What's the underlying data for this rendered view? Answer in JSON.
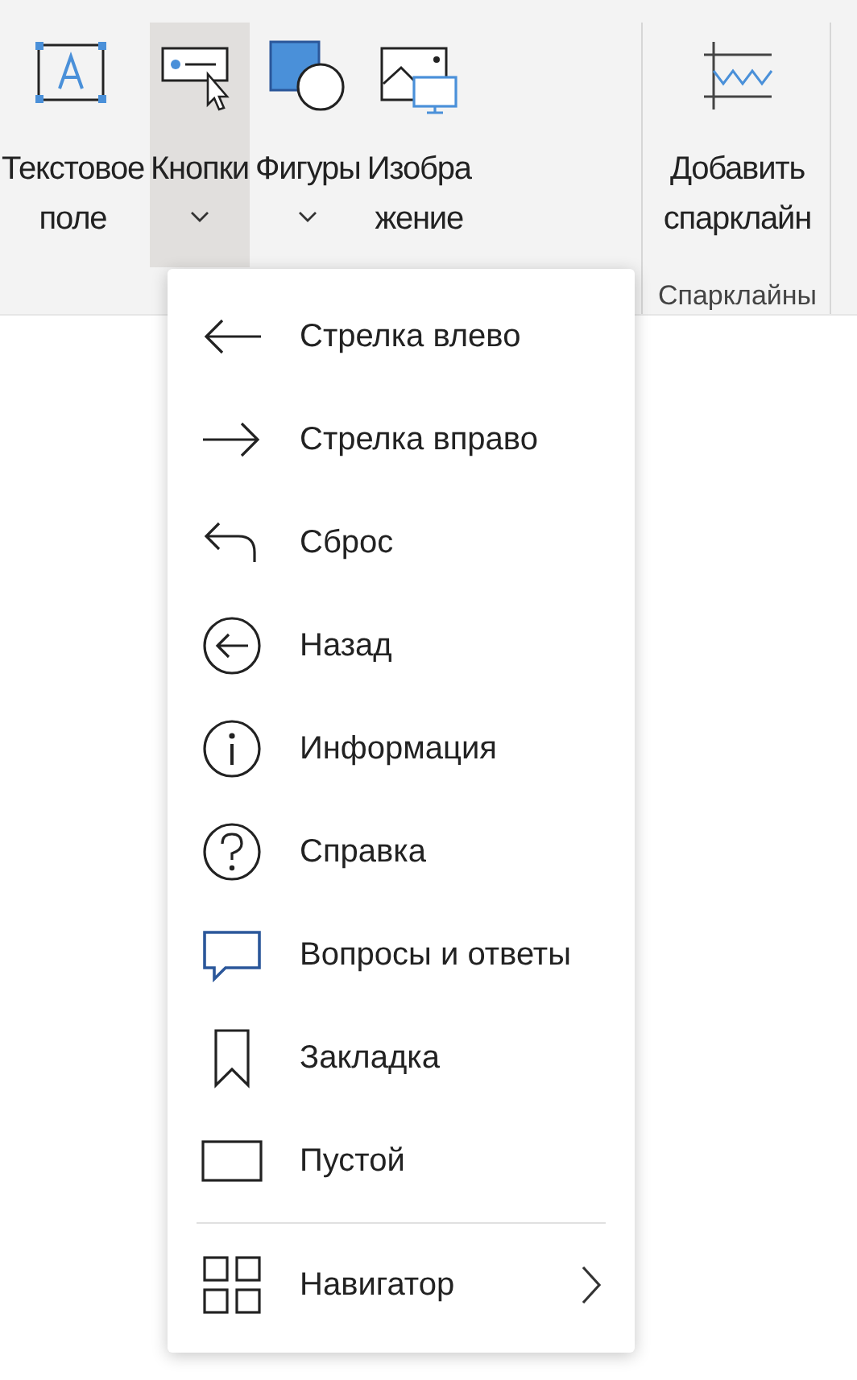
{
  "ribbon": {
    "groups": [
      {
        "buttons": [
          {
            "kind": "textbox",
            "lines": [
              "Текстовое",
              "поле"
            ],
            "dropdown": false,
            "selected": false
          },
          {
            "kind": "buttons",
            "lines": [
              "Кнопки"
            ],
            "dropdown": true,
            "selected": true
          },
          {
            "kind": "shapes",
            "lines": [
              "Фигуры"
            ],
            "dropdown": true,
            "selected": false
          },
          {
            "kind": "picture",
            "lines": [
              "Изобра",
              "жение"
            ],
            "dropdown": false,
            "selected": false
          }
        ]
      },
      {
        "label": "Спарклайны",
        "buttons": [
          {
            "kind": "sparkline",
            "lines": [
              "Добавить",
              "спарклайн"
            ],
            "dropdown": false,
            "selected": false
          }
        ]
      }
    ]
  },
  "menu": {
    "items": [
      {
        "kind": "arrow-left",
        "label": "Стрелка влево"
      },
      {
        "kind": "arrow-right",
        "label": "Стрелка вправо"
      },
      {
        "kind": "reset",
        "label": "Сброс"
      },
      {
        "kind": "back",
        "label": "Назад"
      },
      {
        "kind": "info",
        "label": "Информация"
      },
      {
        "kind": "help",
        "label": "Справка"
      },
      {
        "kind": "qa",
        "label": "Вопросы и ответы"
      },
      {
        "kind": "bookmark",
        "label": "Закладка"
      },
      {
        "kind": "blank",
        "label": "Пустой"
      }
    ],
    "footer": {
      "kind": "navigator",
      "label": "Навигатор",
      "submenu": true
    }
  }
}
